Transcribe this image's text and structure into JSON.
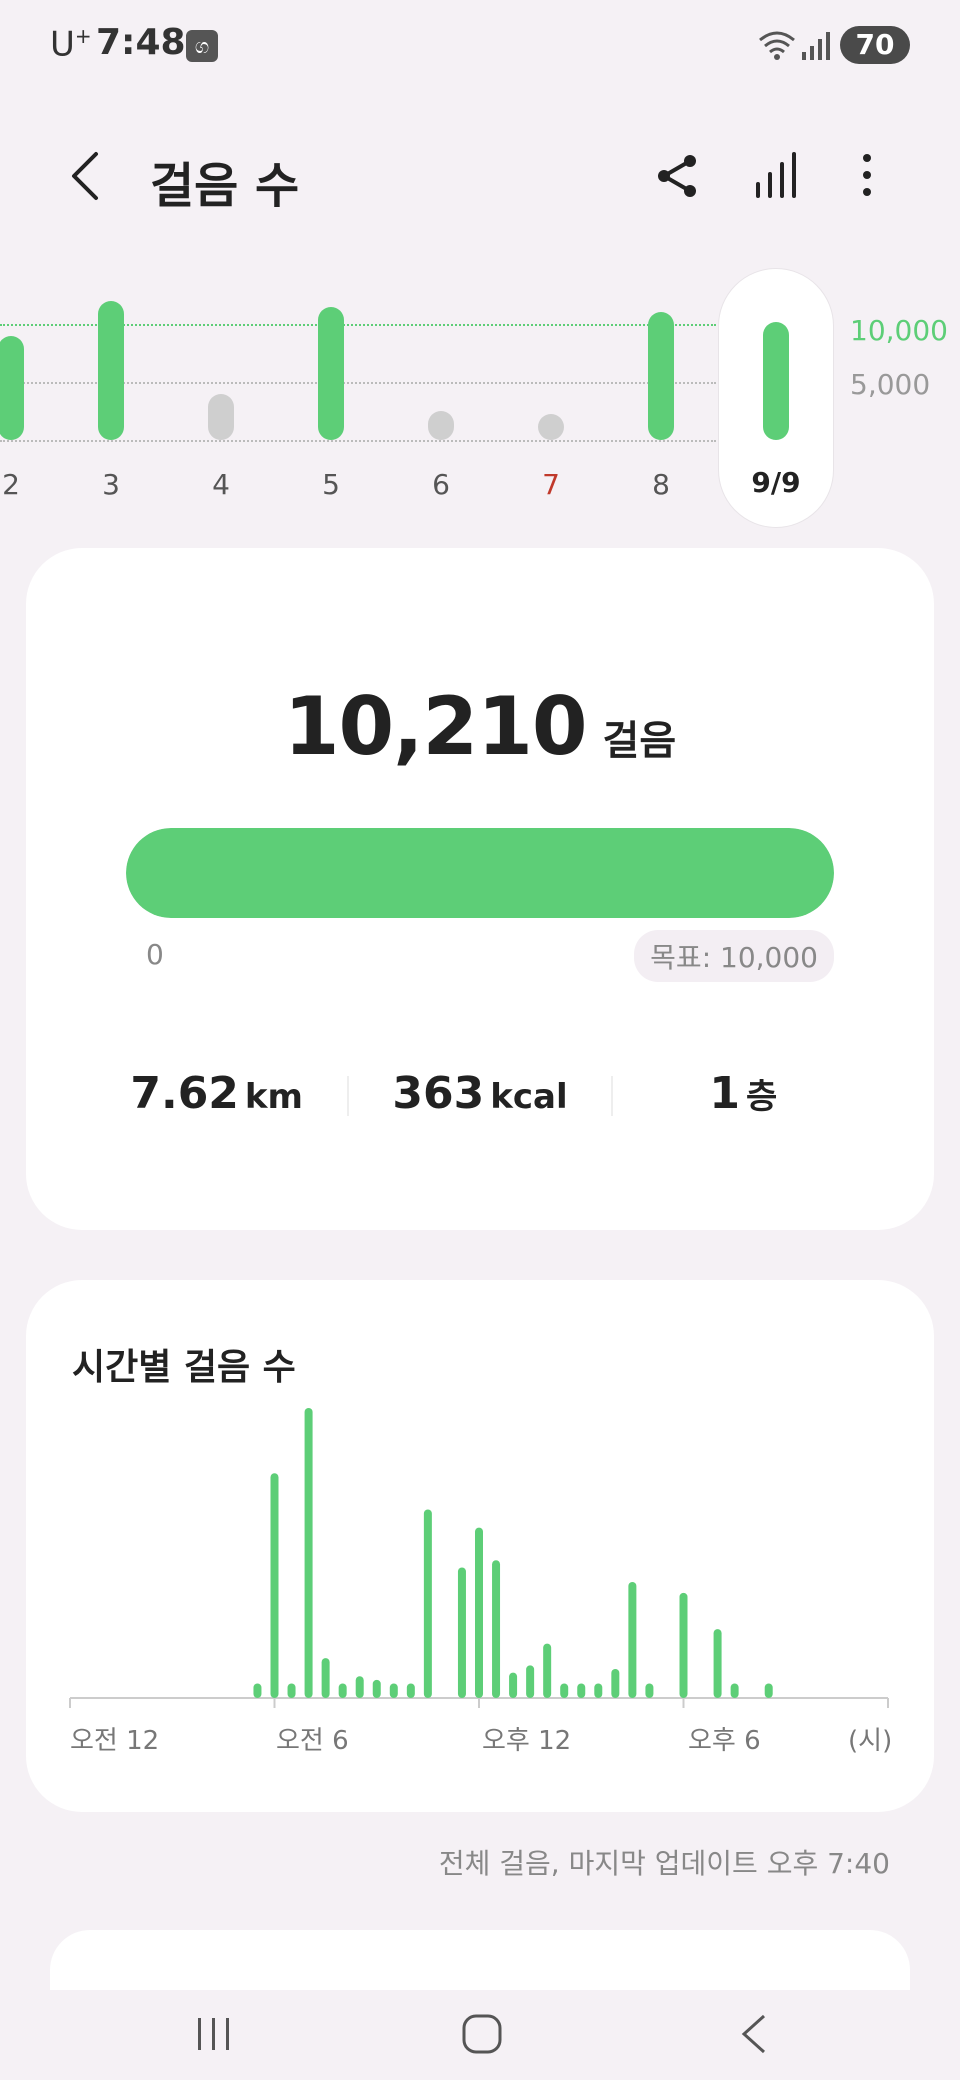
{
  "status_bar": {
    "carrier": "U",
    "carrier_sup": "+",
    "time": "7:48",
    "notification_glyph": "ග",
    "battery": "70"
  },
  "header": {
    "title": "걸음 수"
  },
  "day_strip": {
    "goal_label": "10,000",
    "mid_label": "5,000",
    "days": [
      {
        "label": "2",
        "value": 9000,
        "met": true
      },
      {
        "label": "3",
        "value": 12000,
        "met": true
      },
      {
        "label": "4",
        "value": 4000,
        "met": false
      },
      {
        "label": "5",
        "value": 11500,
        "met": true
      },
      {
        "label": "6",
        "value": 2500,
        "met": false
      },
      {
        "label": "7",
        "value": 1000,
        "met": false
      },
      {
        "label": "8",
        "value": 11000,
        "met": true
      }
    ],
    "selected": {
      "label": "9/9",
      "value": 10210
    }
  },
  "summary": {
    "steps": "10,210",
    "steps_unit": "걸음",
    "progress_fraction": 1.0,
    "min_label": "0",
    "goal_label": "목표: 10,000",
    "distance_value": "7.62",
    "distance_unit": "km",
    "calories_value": "363",
    "calories_unit": "kcal",
    "floors_value": "1",
    "floors_unit": "층"
  },
  "hourly": {
    "title": "시간별 걸음 수",
    "ticks": [
      "오전 12",
      "오전 6",
      "오후 12",
      "오후 6"
    ],
    "unit_label": "(시)"
  },
  "chart_data": {
    "type": "bar",
    "title": "시간별 걸음 수",
    "x": [
      5.5,
      6.0,
      6.5,
      7.0,
      7.5,
      8.0,
      8.5,
      9.0,
      9.5,
      10.0,
      10.5,
      11.5,
      12.0,
      12.5,
      13.0,
      13.5,
      14.0,
      14.5,
      15.0,
      15.5,
      16.0,
      16.5,
      17.0,
      18.0,
      19.0,
      19.5,
      20.5
    ],
    "values": [
      40,
      620,
      40,
      800,
      110,
      40,
      60,
      50,
      40,
      40,
      520,
      360,
      470,
      380,
      70,
      90,
      150,
      40,
      40,
      40,
      80,
      320,
      40,
      290,
      190,
      40,
      40
    ],
    "xlim": [
      0,
      24
    ],
    "xlabel": "(시)",
    "tick_labels": [
      "오전 12",
      "오전 6",
      "오후 12",
      "오후 6"
    ],
    "grid": false
  },
  "footer": {
    "update_note": "전체 걸음, 마지막 업데이트 오후 7:40"
  },
  "colors": {
    "accent_green": "#5dce77",
    "inactive_gray": "#cfcfcf",
    "weekend_red": "#c0392b",
    "background": "#f5f1f5"
  },
  "icons": {
    "back": "back-arrow-icon",
    "share": "share-icon",
    "stats": "bar-chart-icon",
    "more": "more-vertical-icon"
  }
}
